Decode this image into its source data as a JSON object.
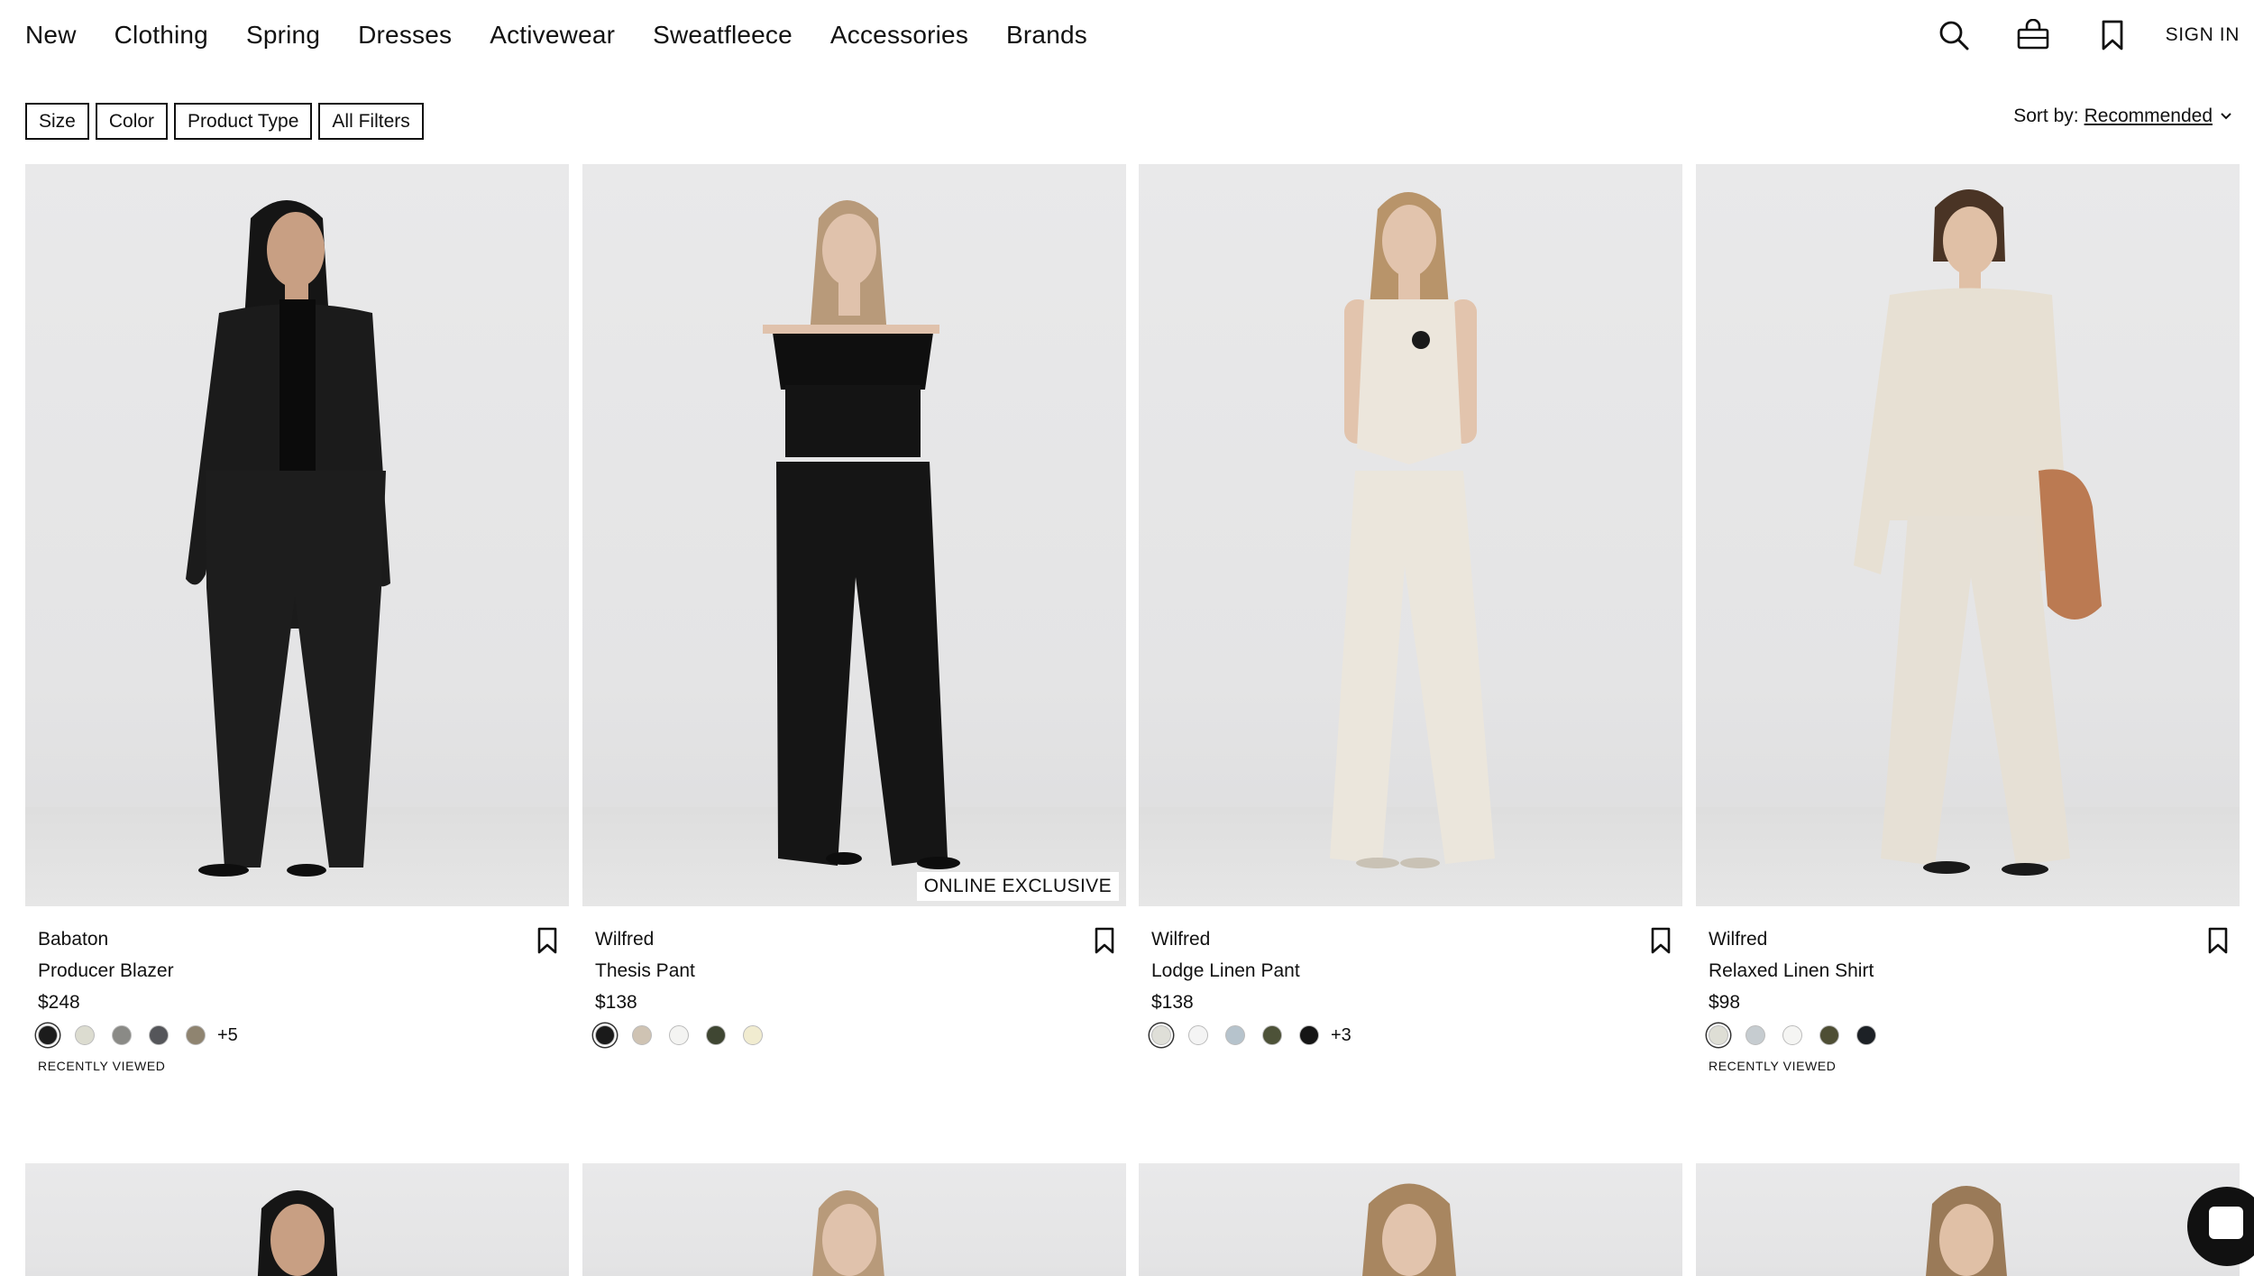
{
  "nav": {
    "links": [
      "New",
      "Clothing",
      "Spring",
      "Dresses",
      "Activewear",
      "Sweatfleece",
      "Accessories",
      "Brands"
    ],
    "sign_in": "SIGN IN",
    "icons": [
      "search-icon",
      "bag-icon",
      "bookmark-icon"
    ]
  },
  "filters": {
    "chips": [
      "Size",
      "Color",
      "Product Type",
      "All Filters"
    ],
    "sort_label": "Sort by:",
    "sort_value": "Recommended"
  },
  "products": [
    {
      "brand": "Babaton",
      "name": "Producer Blazer",
      "price": "$248",
      "badge": "",
      "swatches": [
        "#1c1c1c",
        "#dcdcd0",
        "#8a8a86",
        "#55565a",
        "#8f8470"
      ],
      "more_colors": "+5",
      "recently_viewed": "RECENTLY VIEWED",
      "outfit": "black-suit"
    },
    {
      "brand": "Wilfred",
      "name": "Thesis Pant",
      "price": "$138",
      "badge": "ONLINE EXCLUSIVE",
      "swatches": [
        "#1a1a1a",
        "#cfc3b3",
        "#f4f4f2",
        "#3f4632",
        "#f1ecd0"
      ],
      "more_colors": "",
      "recently_viewed": "",
      "outfit": "black-offshoulder"
    },
    {
      "brand": "Wilfred",
      "name": "Lodge Linen Pant",
      "price": "$138",
      "badge": "",
      "swatches": [
        "#dfdfd8",
        "#f4f4f4",
        "#b6c3cc",
        "#4d5238",
        "#151515"
      ],
      "more_colors": "+3",
      "recently_viewed": "",
      "outfit": "cream-vest"
    },
    {
      "brand": "Wilfred",
      "name": "Relaxed Linen Shirt",
      "price": "$98",
      "badge": "",
      "swatches": [
        "#deded5",
        "#c6ccd0",
        "#f5f5f3",
        "#4e4e34",
        "#1d2126"
      ],
      "more_colors": "",
      "recently_viewed": "RECENTLY VIEWED",
      "outfit": "cream-linen"
    }
  ],
  "colors": {
    "text": "#111111",
    "photo_bg": "#e7e7e8"
  }
}
